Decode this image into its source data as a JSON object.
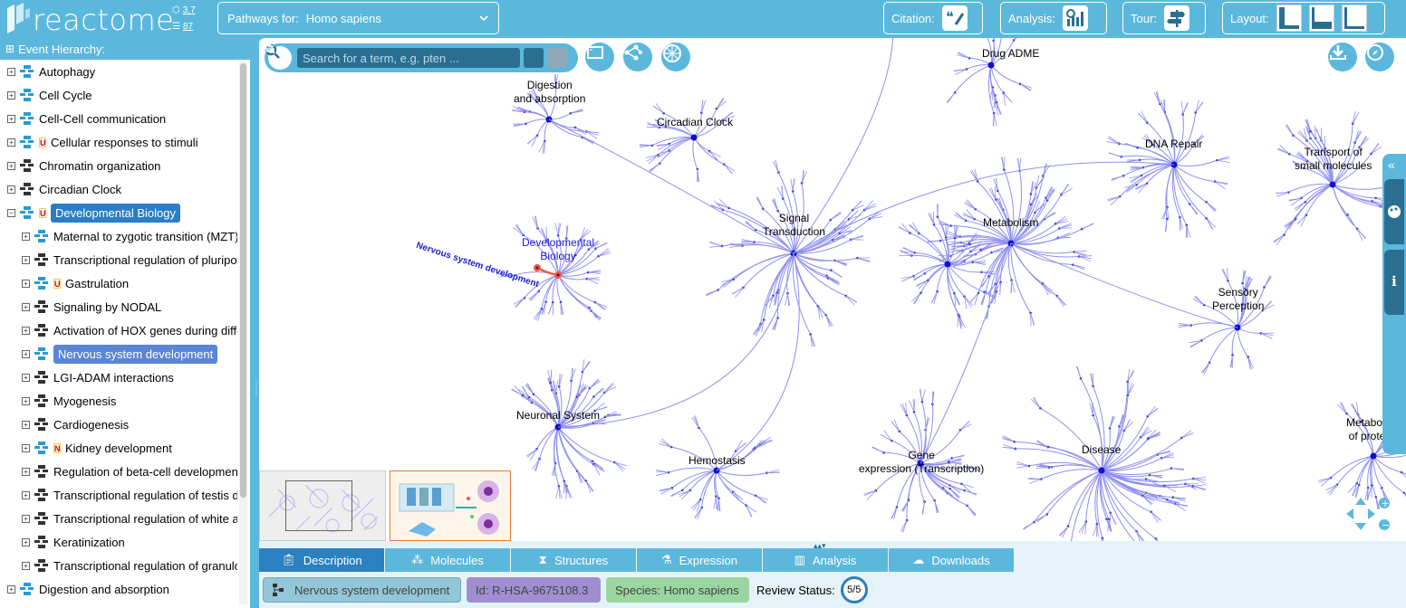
{
  "header": {
    "logo_text": "reactome",
    "version_1": "3.7",
    "version_2": "87",
    "species_label": "Pathways for:",
    "species_value": "Homo sapiens",
    "citation_label": "Citation:",
    "analysis_label": "Analysis:",
    "tour_label": "Tour:",
    "layout_label": "Layout:"
  },
  "hierarchy": {
    "title": "Event Hierarchy:",
    "items": [
      {
        "label": "Autophagy",
        "badge": ""
      },
      {
        "label": "Cell Cycle",
        "badge": ""
      },
      {
        "label": "Cell-Cell communication",
        "badge": ""
      },
      {
        "label": "Cellular responses to stimuli",
        "badge": "U"
      },
      {
        "label": "Chromatin organization",
        "badge": ""
      },
      {
        "label": "Circadian Clock",
        "badge": ""
      },
      {
        "label": "Developmental Biology",
        "badge": "U"
      },
      {
        "label": "Maternal to zygotic transition (MZT)",
        "badge": ""
      },
      {
        "label": "Transcriptional regulation of pluripotent stem cells",
        "badge": ""
      },
      {
        "label": "Gastrulation",
        "badge": "U"
      },
      {
        "label": "Signaling by NODAL",
        "badge": ""
      },
      {
        "label": "Activation of HOX genes during differentiation",
        "badge": ""
      },
      {
        "label": "Nervous system development",
        "badge": ""
      },
      {
        "label": "LGI-ADAM interactions",
        "badge": ""
      },
      {
        "label": "Myogenesis",
        "badge": ""
      },
      {
        "label": "Cardiogenesis",
        "badge": ""
      },
      {
        "label": "Kidney development",
        "badge": "N"
      },
      {
        "label": "Regulation of beta-cell development",
        "badge": ""
      },
      {
        "label": "Transcriptional regulation of testis differentiation",
        "badge": ""
      },
      {
        "label": "Transcriptional regulation of white adipocyte differentiation",
        "badge": ""
      },
      {
        "label": "Keratinization",
        "badge": ""
      },
      {
        "label": "Transcriptional regulation of granulopoiesis",
        "badge": ""
      },
      {
        "label": "Digestion and absorption",
        "badge": ""
      }
    ]
  },
  "diagram": {
    "search_placeholder": "Search for a term, e.g. pten ...",
    "labels": {
      "drug_adme": "Drug ADME",
      "digestion_1": "Digestion",
      "digestion_2": "and absorption",
      "circadian": "Circadian Clock",
      "dna_repair": "DNA Repair",
      "transport_1": "Transport of",
      "transport_2": "small molecules",
      "signal_1": "Signal",
      "signal_2": "Transduction",
      "metabolism": "Metabolism",
      "devbio_1": "Developmental",
      "devbio_2": "Biology",
      "nervous": "Nervous system development",
      "sensory_1": "Sensory",
      "sensory_2": "Perception",
      "neuronal": "Neuronal System",
      "hemostasis": "Hemostasis",
      "gene_1": "Gene",
      "gene_2": "expression (Transcription)",
      "disease": "Disease",
      "metab_prot_1": "Metabolism",
      "metab_prot_2": "of proteins"
    }
  },
  "bottom": {
    "tabs": [
      "Description",
      "Molecules",
      "Structures",
      "Expression",
      "Analysis",
      "Downloads"
    ],
    "name_chip": "Nervous system development",
    "id_chip": "Id: R-HSA-9675108.3",
    "species_chip": "Species: Homo sapiens",
    "review_label": "Review Status:",
    "review_value": "5/5"
  },
  "colors": {
    "brand": "#5bb8dc",
    "selected": "#2a7fc4",
    "diagram_lines": "#8f8ff0",
    "highlight": "#e85d4a"
  }
}
